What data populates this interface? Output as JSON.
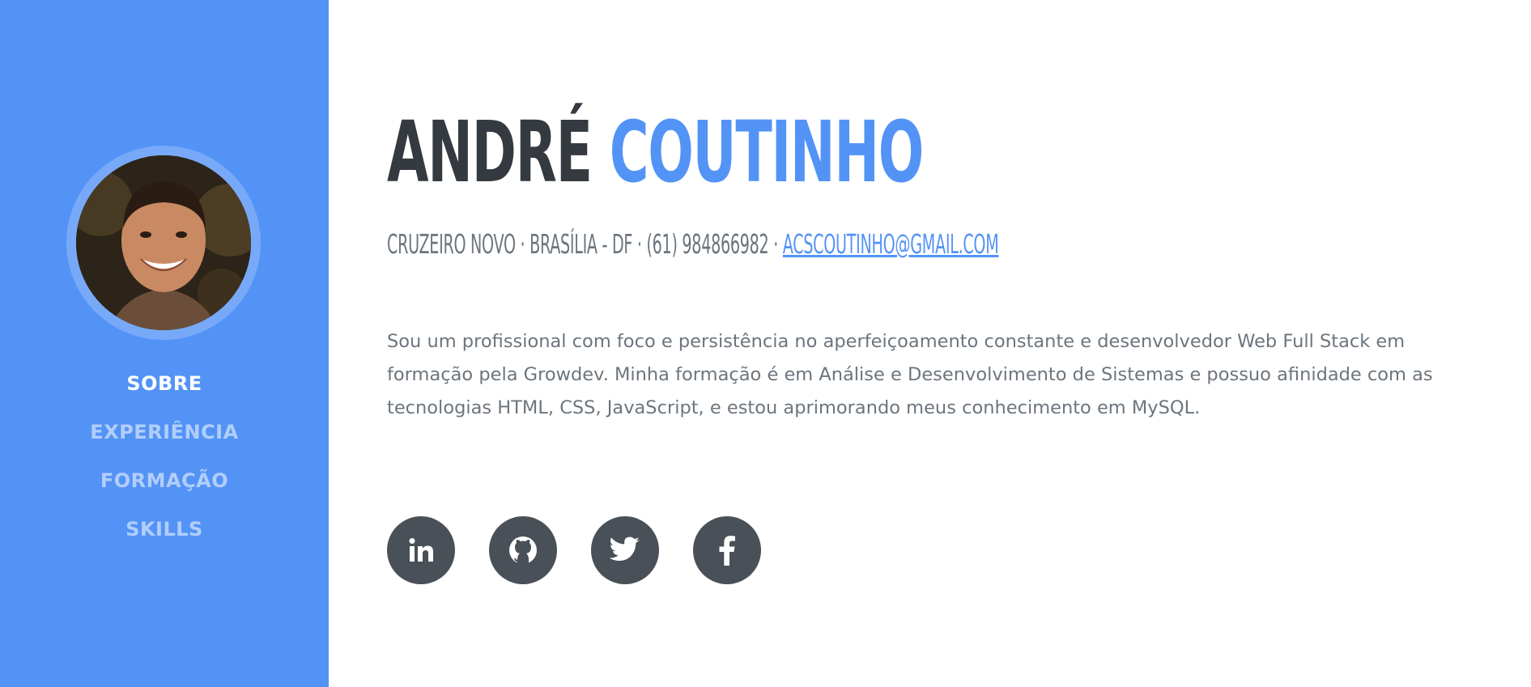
{
  "profile": {
    "first_name": "ANDRÉ",
    "last_name": "COUTINHO",
    "address": "CRUZEIRO NOVO · BRASÍLIA - DF · (61) 984866982 · ",
    "email": "ACSCOUTINHO@GMAIL.COM",
    "bio": "Sou um profissional com foco e persistência no aperfeiçoamento constante e desenvolvedor Web Full Stack em formação pela Growdev. Minha formação é em Análise e Desenvolvimento de Sistemas e possuo afinidade com as tecnologias HTML, CSS, JavaScript, e estou aprimorando meus conhecimento em MySQL."
  },
  "nav": {
    "items": [
      {
        "label": "SOBRE",
        "active": true
      },
      {
        "label": "EXPERIÊNCIA",
        "active": false
      },
      {
        "label": "FORMAÇÃO",
        "active": false
      },
      {
        "label": "SKILLS",
        "active": false
      }
    ]
  },
  "social": [
    {
      "icon": "linkedin-icon"
    },
    {
      "icon": "github-icon"
    },
    {
      "icon": "twitter-icon"
    },
    {
      "icon": "facebook-icon"
    }
  ],
  "colors": {
    "primary": "#5393f6",
    "dark": "#343a40",
    "muted": "#6c757d",
    "social_bg": "#495057"
  }
}
